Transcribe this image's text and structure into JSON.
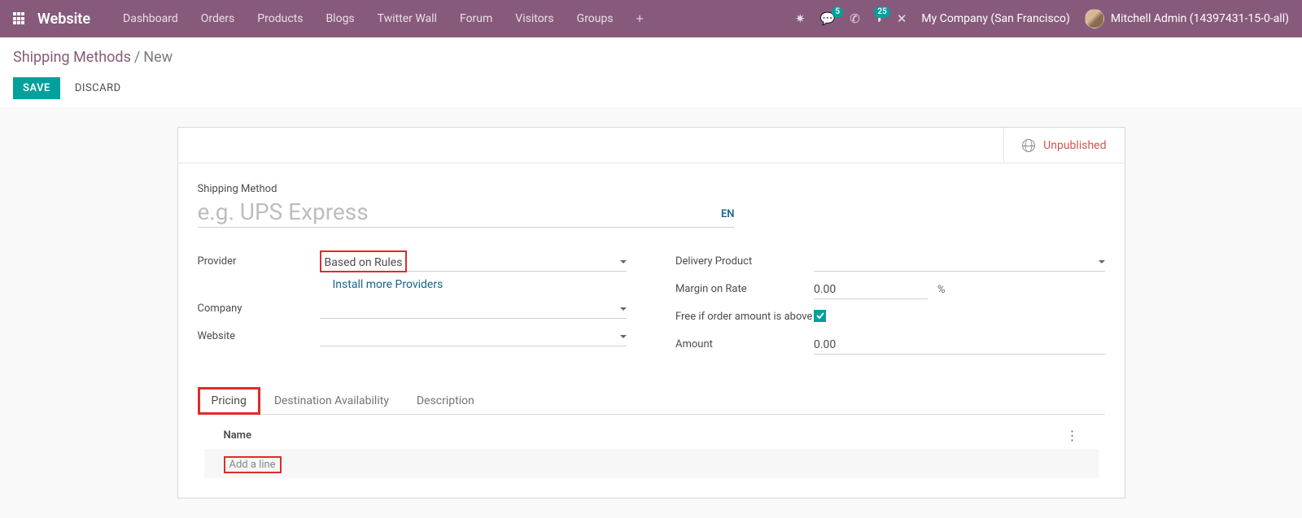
{
  "nav": {
    "brand": "Website",
    "items": [
      "Dashboard",
      "Orders",
      "Products",
      "Blogs",
      "Twitter Wall",
      "Forum",
      "Visitors",
      "Groups"
    ],
    "tray": {
      "messages_badge": "5",
      "activities_badge": "25"
    },
    "company": "My Company (San Francisco)",
    "user": "Mitchell Admin (14397431-15-0-all)"
  },
  "breadcrumb": {
    "parent": "Shipping Methods",
    "current": "New"
  },
  "actions": {
    "save": "SAVE",
    "discard": "DISCARD"
  },
  "publish": {
    "label": "Unpublished"
  },
  "form": {
    "shipping_method_label": "Shipping Method",
    "shipping_method_placeholder": "e.g. UPS Express",
    "lang_button": "EN",
    "left": {
      "provider_label": "Provider",
      "provider_value": "Based on Rules",
      "install_link": "Install more Providers",
      "company_label": "Company",
      "website_label": "Website"
    },
    "right": {
      "delivery_product_label": "Delivery Product",
      "margin_label": "Margin on Rate",
      "margin_value": "0.00",
      "margin_suffix": "%",
      "free_label": "Free if order amount is above",
      "free_checked": true,
      "amount_label": "Amount",
      "amount_value": "0.00"
    }
  },
  "tabs": [
    "Pricing",
    "Destination Availability",
    "Description"
  ],
  "list": {
    "header": "Name",
    "add_line": "Add a line"
  }
}
